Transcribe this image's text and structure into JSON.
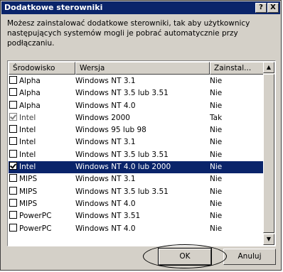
{
  "dialog": {
    "title": "Dodatkowe sterowniki",
    "help_label": "?",
    "close_label": "X",
    "description": "Możesz zainstalować dodatkowe sterowniki, tak aby użytkownicy następujących systemów mogli je pobrać automatycznie przy podłączaniu."
  },
  "table": {
    "columns": [
      "Środowisko",
      "Wersja",
      "Zainstal..."
    ],
    "rows": [
      {
        "env": "Alpha",
        "version": "Windows NT 3.1",
        "installed": "Nie",
        "checked": false,
        "disabled": false,
        "selected": false
      },
      {
        "env": "Alpha",
        "version": "Windows NT 3.5 lub 3.51",
        "installed": "Nie",
        "checked": false,
        "disabled": false,
        "selected": false
      },
      {
        "env": "Alpha",
        "version": "Windows NT 4.0",
        "installed": "Nie",
        "checked": false,
        "disabled": false,
        "selected": false
      },
      {
        "env": "Intel",
        "version": "Windows 2000",
        "installed": "Tak",
        "checked": true,
        "disabled": true,
        "selected": false
      },
      {
        "env": "Intel",
        "version": "Windows 95 lub 98",
        "installed": "Nie",
        "checked": false,
        "disabled": false,
        "selected": false
      },
      {
        "env": "Intel",
        "version": "Windows NT 3.1",
        "installed": "Nie",
        "checked": false,
        "disabled": false,
        "selected": false
      },
      {
        "env": "Intel",
        "version": "Windows NT 3.5 lub 3.51",
        "installed": "Nie",
        "checked": false,
        "disabled": false,
        "selected": false
      },
      {
        "env": "Intel",
        "version": "Windows NT 4.0 lub 2000",
        "installed": "Nie",
        "checked": true,
        "disabled": false,
        "selected": true
      },
      {
        "env": "MIPS",
        "version": "Windows NT 3.1",
        "installed": "Nie",
        "checked": false,
        "disabled": false,
        "selected": false
      },
      {
        "env": "MIPS",
        "version": "Windows NT 3.5 lub 3.51",
        "installed": "Nie",
        "checked": false,
        "disabled": false,
        "selected": false
      },
      {
        "env": "MIPS",
        "version": "Windows NT 4.0",
        "installed": "Nie",
        "checked": false,
        "disabled": false,
        "selected": false
      },
      {
        "env": "PowerPC",
        "version": "Windows NT 3.51",
        "installed": "Nie",
        "checked": false,
        "disabled": false,
        "selected": false
      },
      {
        "env": "PowerPC",
        "version": "Windows NT 4.0",
        "installed": "Nie",
        "checked": false,
        "disabled": false,
        "selected": false
      }
    ]
  },
  "buttons": {
    "ok_label": "OK",
    "cancel_label": "Anuluj"
  },
  "icons": {
    "scroll_up": "scroll-up-arrow-icon",
    "scroll_down": "scroll-down-arrow-icon"
  },
  "colors": {
    "titlebar": "#0a246a",
    "selection": "#0a246a",
    "face": "#d4d0c8"
  }
}
